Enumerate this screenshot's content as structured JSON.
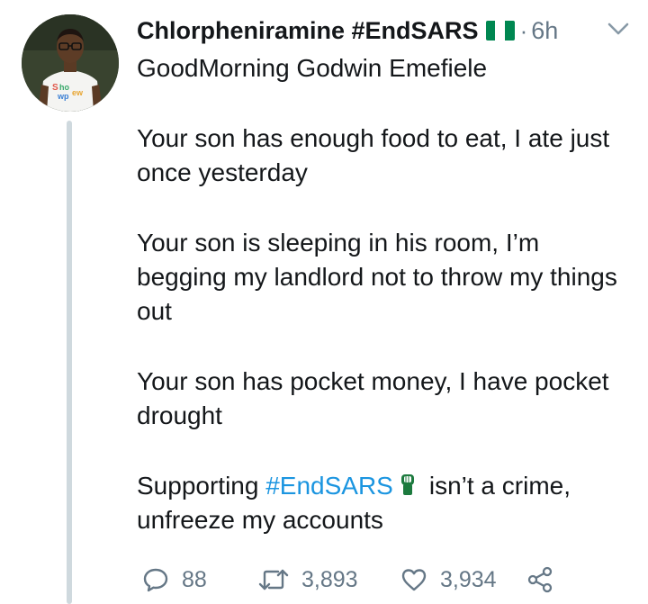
{
  "tweet": {
    "display_name": "Chlorpheniramine #EndSARS",
    "separator": "·",
    "time": "6h",
    "body": {
      "p1": "GoodMorning Godwin Emefiele",
      "p2": "Your son has enough food to eat, I ate just once yesterday",
      "p3": "Your son is sleeping in his room, I’m begging my landlord not to throw my things out",
      "p4": "Your son has pocket money, I have pocket drought",
      "p5_before": "Supporting ",
      "p5_hashtag": "#EndSARS",
      "p5_after": "isn’t a crime, unfreeze my accounts"
    },
    "actions": {
      "reply_count": "88",
      "retweet_count": "3,893",
      "like_count": "3,934"
    }
  },
  "icons": {
    "avatar": "profile-photo",
    "flag": "nigeria-flag-icon",
    "menu": "chevron-down-icon",
    "hashtag_emoji": "raised-fist-icon",
    "reply": "reply-icon",
    "retweet": "retweet-icon",
    "like": "heart-icon",
    "share": "share-icon"
  },
  "colors": {
    "text": "#14171a",
    "secondary": "#657786",
    "link": "#1b95e0",
    "thread_line": "#cfd9de",
    "flag_green": "#008751",
    "flag_white": "#ffffff"
  }
}
